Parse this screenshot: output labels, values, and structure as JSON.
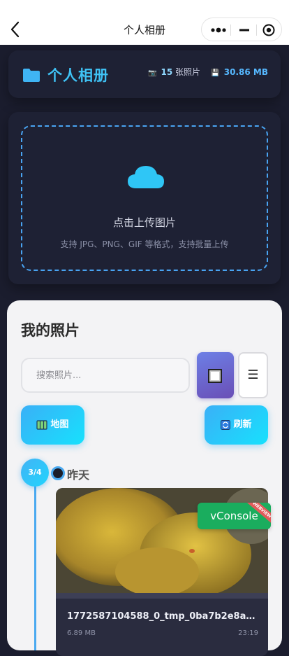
{
  "nav": {
    "title": "个人相册"
  },
  "header": {
    "title": "个人相册",
    "photo_count": "15",
    "photo_unit": "张照片",
    "storage_size": "30.86 MB"
  },
  "upload": {
    "title": "点击上传图片",
    "hint": "支持 JPG、PNG、GIF 等格式，支持批量上传"
  },
  "photos": {
    "title": "我的照片",
    "search_placeholder": "搜索照片...",
    "list_icon": "☰",
    "map_label": "地图",
    "refresh_label": "刷新",
    "page_badge": "3/4",
    "group_label": "昨天",
    "card": {
      "filename": "1772587104588_0_tmp_0ba7b2e8a1...",
      "size": "6.89 MB",
      "time": "23:19"
    }
  },
  "vconsole": {
    "label": "vConsole",
    "ribbon": "WEBVIEW"
  },
  "colors": {
    "accent": "#3fc2f5",
    "background": "#1b1d2e",
    "panel": "#f3f3f5",
    "vconsole_green": "#1aad5e"
  },
  "icons": [
    "back-arrow-icon",
    "more-dots-icon",
    "minimize-icon",
    "close-circle-icon",
    "folder-icon",
    "camera-icon",
    "storage-icon",
    "cloud-upload-icon",
    "grid-view-icon",
    "list-icon",
    "map-icon",
    "refresh-icon"
  ]
}
